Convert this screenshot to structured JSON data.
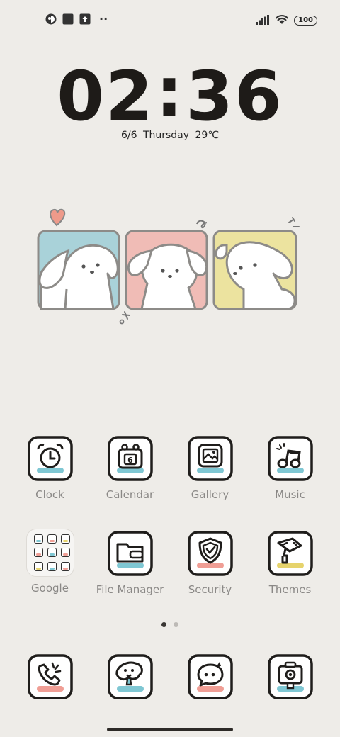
{
  "status_bar": {
    "battery": "100",
    "more_indicator": "··"
  },
  "lock": {
    "time_h1": "0",
    "time_h2": "2",
    "time_sep": ":",
    "time_m1": "3",
    "time_m2": "6",
    "date": "6/6",
    "weekday": "Thursday",
    "temperature": "29℃"
  },
  "widget": {
    "panel_colors": [
      "#a9d2d9",
      "#f0bcb6",
      "#ece39f"
    ],
    "heart_color": "#ee9a8a"
  },
  "apps_row1": [
    {
      "label": "Clock",
      "icon": "alarm-clock-icon",
      "accent": "#7fc7d3"
    },
    {
      "label": "Calendar",
      "icon": "calendar-icon",
      "accent": "#7fc7d3",
      "day": "6"
    },
    {
      "label": "Gallery",
      "icon": "picture-icon",
      "accent": "#7fc7d3"
    },
    {
      "label": "Music",
      "icon": "music-note-icon",
      "accent": "#7fc7d3"
    }
  ],
  "apps_row2": [
    {
      "label": "Google",
      "icon": "folder-icon"
    },
    {
      "label": "File Manager",
      "icon": "file-folder-icon",
      "accent": "#7fc7d3"
    },
    {
      "label": "Security",
      "icon": "shield-icon",
      "accent": "#f09e95"
    },
    {
      "label": "Themes",
      "icon": "paint-roller-icon",
      "accent": "#e6d36c"
    }
  ],
  "folder_minis": [
    "#7fc7d3",
    "#f09e95",
    "#e6d36c",
    "#f09e95",
    "#7fc7d3",
    "#f09e95",
    "#e6d36c",
    "#7fc7d3",
    "#f09e95"
  ],
  "dock": [
    {
      "icon": "phone-icon",
      "accent": "#f09e95"
    },
    {
      "icon": "messages-icon",
      "accent": "#7fc7d3"
    },
    {
      "icon": "chat-bubble-icon",
      "accent": "#f09e95"
    },
    {
      "icon": "camera-icon",
      "accent": "#7fc7d3"
    }
  ],
  "page_indicator": {
    "count": 2,
    "active": 1
  }
}
